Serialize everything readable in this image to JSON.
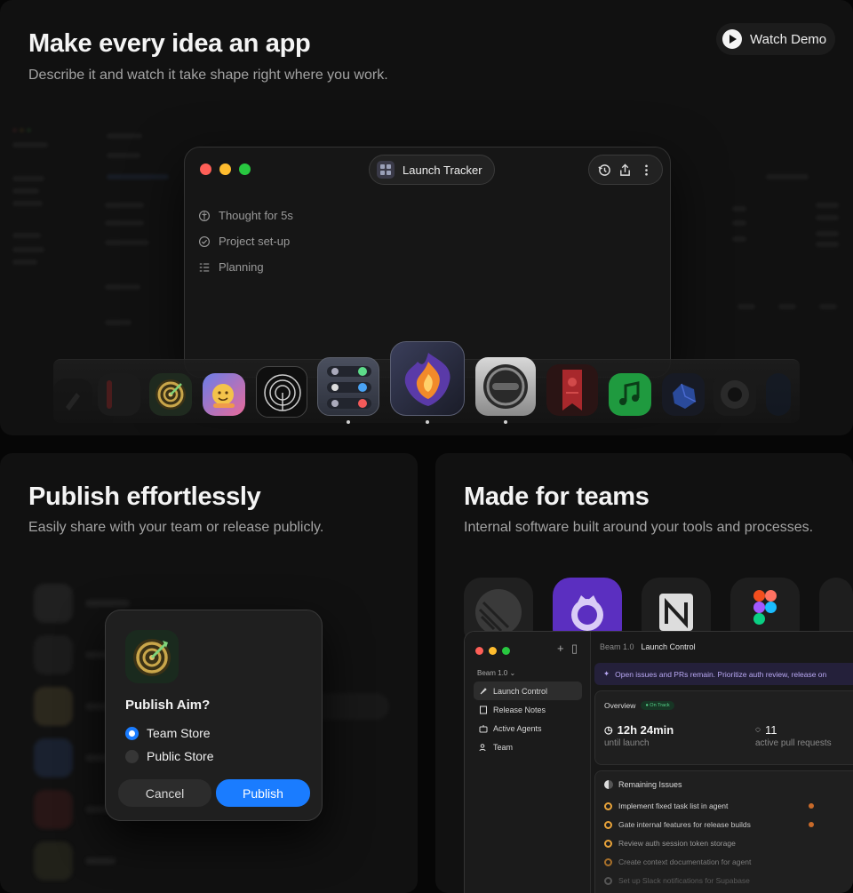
{
  "hero": {
    "headline": "Make every idea an app",
    "subline": "Describe it and watch it take shape right where you work.",
    "watch_demo": "Watch Demo",
    "app_window": {
      "title": "Launch Tracker",
      "steps": [
        "Thought for 5s",
        "Project set-up",
        "Planning"
      ]
    },
    "dock_icons": [
      "rocket-app",
      "dark-app",
      "aim-app",
      "emoji-app",
      "spiral-app",
      "integrations-app",
      "flame-app",
      "aperture-app",
      "bookmark-app",
      "music-app",
      "gem-app",
      "camera-app"
    ]
  },
  "publish": {
    "headline": "Publish effortlessly",
    "subline": "Easily share with your team or release publicly.",
    "dialog": {
      "title": "Publish Aim?",
      "options": [
        "Team Store",
        "Public Store"
      ],
      "selected": "Team Store",
      "cancel": "Cancel",
      "publish": "Publish"
    }
  },
  "teams": {
    "headline": "Made for teams",
    "subline": "Internal software built around your tools and processes.",
    "tool_logos": [
      "linear-logo",
      "github-logo",
      "notion-logo",
      "figma-logo"
    ],
    "app": {
      "workspace": "Beam 1.0",
      "breadcrumb_parent": "Beam 1.0",
      "breadcrumb_current": "Launch Control",
      "nav": [
        "Launch Control",
        "Release Notes",
        "Active Agents",
        "Team"
      ],
      "banner": "Open issues and PRs remain. Prioritize auth review, release on",
      "overview_title": "Overview",
      "overview_badge": "On Track",
      "metric_time": "12h 24min",
      "metric_time_label": "until launch",
      "metric_prs": "11",
      "metric_prs_label": "active pull requests",
      "issues_title": "Remaining Issues",
      "issues": [
        "Implement fixed task list in agent",
        "Gate internal features for release builds",
        "Review auth session token storage",
        "Create context documentation for agent",
        "Set up Slack notifications for Supabase"
      ]
    }
  },
  "colors": {
    "accent_blue": "#1a7cff",
    "background": "#111111",
    "banner_text": "#b9a8f4"
  }
}
